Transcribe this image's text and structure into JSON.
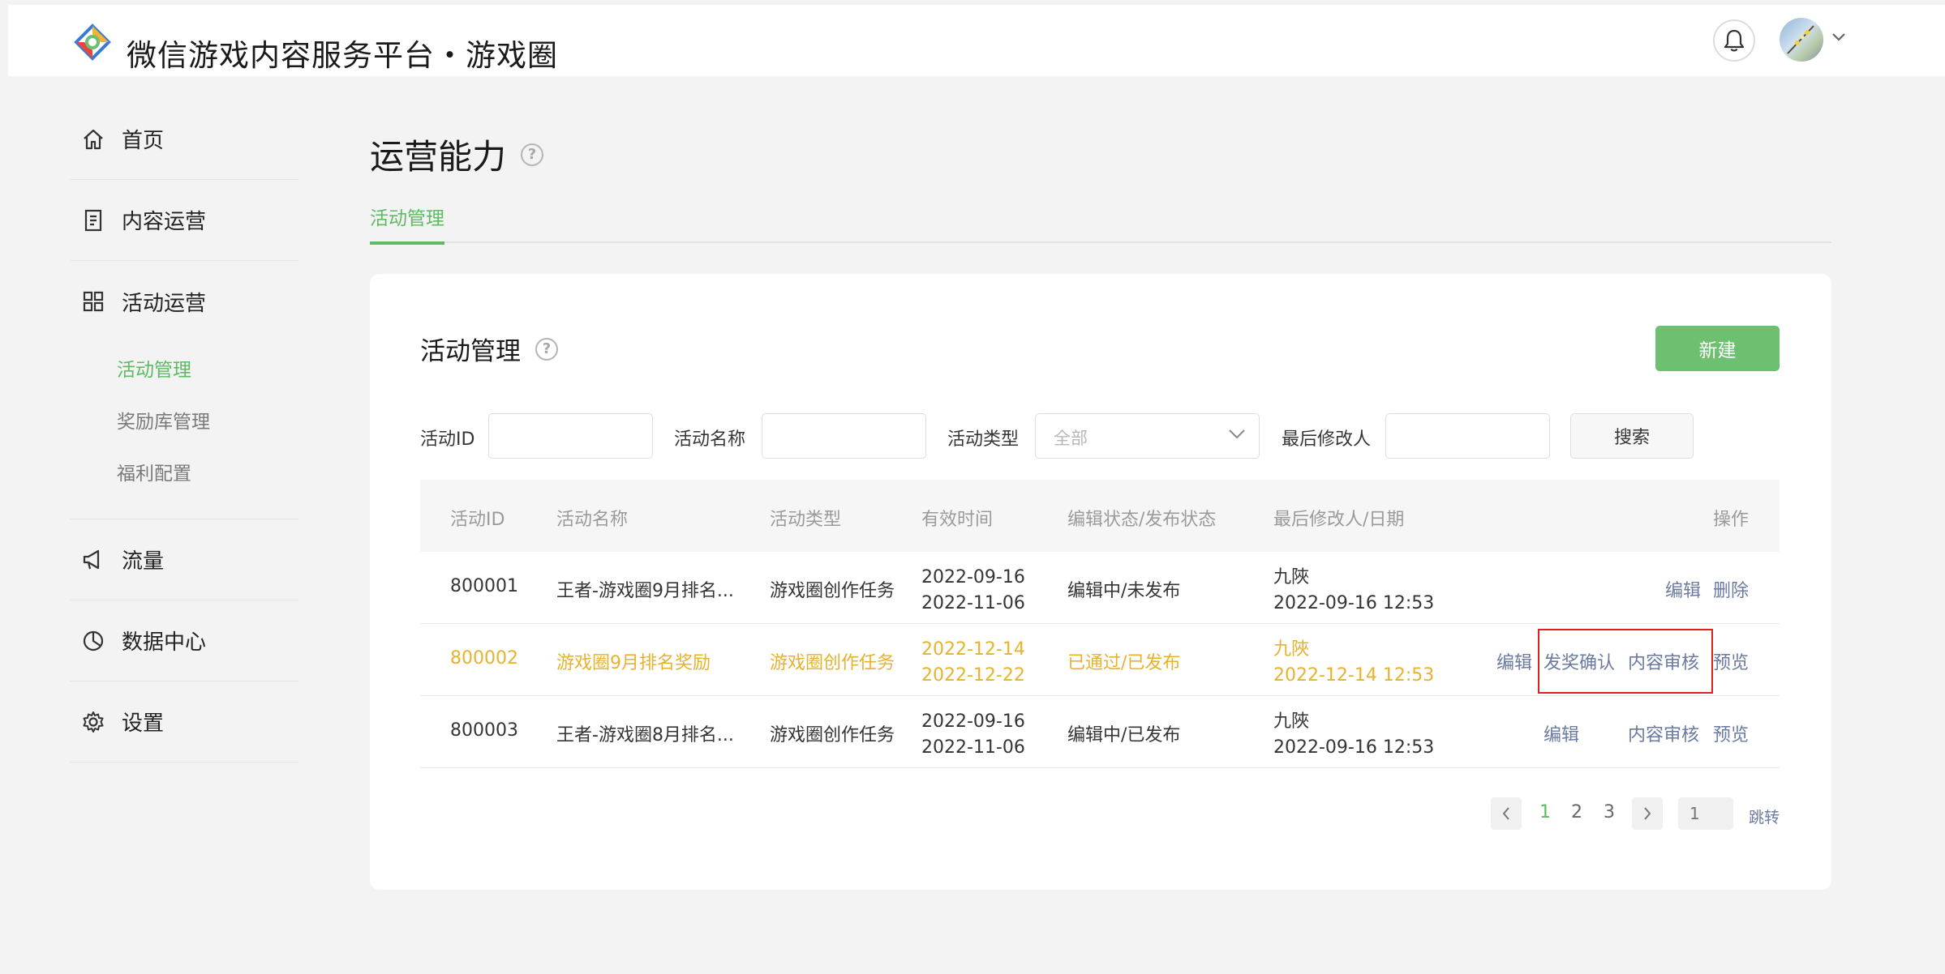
{
  "header": {
    "brand": "微信游戏内容服务平台・游戏圈",
    "bell_icon": "bell-icon",
    "avatar_icon": "user-avatar"
  },
  "sidebar": {
    "items": [
      {
        "label": "首页",
        "icon": "home-icon"
      },
      {
        "label": "内容运营",
        "icon": "document-icon"
      },
      {
        "label": "活动运营",
        "icon": "grid-icon",
        "children": [
          {
            "label": "活动管理",
            "active": true
          },
          {
            "label": "奖励库管理"
          },
          {
            "label": "福利配置"
          }
        ]
      },
      {
        "label": "流量",
        "icon": "megaphone-icon"
      },
      {
        "label": "数据中心",
        "icon": "pie-chart-icon"
      },
      {
        "label": "设置",
        "icon": "gear-icon"
      }
    ]
  },
  "page": {
    "title": "运营能力",
    "tab": "活动管理"
  },
  "card": {
    "title": "活动管理",
    "new_button": "新建",
    "filters": {
      "id_label": "活动ID",
      "name_label": "活动名称",
      "type_label": "活动类型",
      "type_value": "全部",
      "editor_label": "最后修改人",
      "search_button": "搜索"
    },
    "table": {
      "headers": [
        "活动ID",
        "活动名称",
        "活动类型",
        "有效时间",
        "编辑状态/发布状态",
        "最后修改人/日期",
        "操作"
      ],
      "rows": [
        {
          "id": "800001",
          "name": "王者-游戏圈9月排名...",
          "type": "游戏圈创作任务",
          "start": "2022-09-16",
          "end": "2022-11-06",
          "status": "编辑中/未发布",
          "editor": "九陜",
          "date": "2022-09-16 12:53",
          "actions": [
            "编辑",
            "删除"
          ]
        },
        {
          "id": "800002",
          "name": "游戏圈9月排名奖励",
          "type": "游戏圈创作任务",
          "start": "2022-12-14",
          "end": "2022-12-22",
          "status": "已通过/已发布",
          "editor": "九陜",
          "date": "2022-12-14 12:53",
          "actions": [
            "编辑",
            "发奖确认",
            "内容审核",
            "预览"
          ]
        },
        {
          "id": "800003",
          "name": "王者-游戏圈8月排名...",
          "type": "游戏圈创作任务",
          "start": "2022-09-16",
          "end": "2022-11-06",
          "status": "编辑中/已发布",
          "editor": "九陜",
          "date": "2022-09-16 12:53",
          "actions": [
            "编辑",
            "内容审核",
            "预览"
          ]
        }
      ]
    },
    "pagination": {
      "pages": [
        "1",
        "2",
        "3"
      ],
      "current": "1",
      "jump_placeholder": "1",
      "jump_label": "跳转"
    }
  },
  "colors": {
    "accent": "#5dbb63",
    "highlight_row": "#e7b22e",
    "link": "#6a7aa0",
    "annotation_box": "#e02020"
  }
}
